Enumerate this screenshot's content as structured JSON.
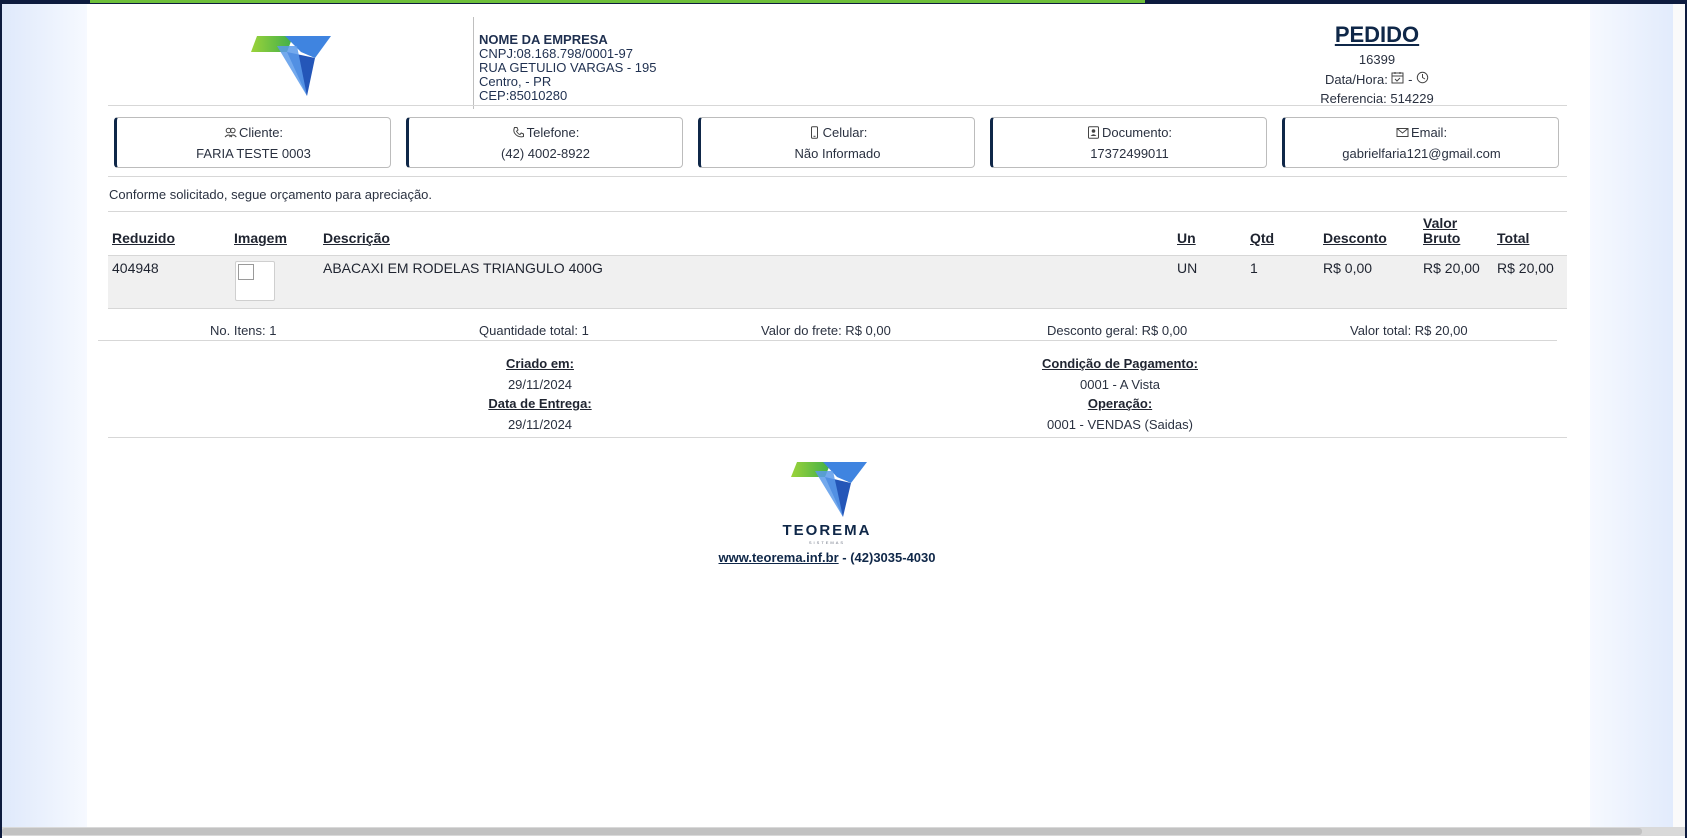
{
  "header": {
    "company_name": "NOME DA EMPRESA",
    "cnpj": "CNPJ:08.168.798/0001-97",
    "street": "RUA GETULIO VARGAS - 195",
    "city": "Centro, - PR",
    "cep": "CEP:85010280",
    "order_title": "PEDIDO",
    "order_number": "16399",
    "datetime_label": "Data/Hora:",
    "datetime_separator": "-",
    "reference": "Referencia: 514229"
  },
  "cards": [
    {
      "label": "Cliente:",
      "value": "FARIA TESTE 0003",
      "icon": "users-icon"
    },
    {
      "label": "Telefone:",
      "value": "(42) 4002-8922",
      "icon": "phone-icon"
    },
    {
      "label": "Celular:",
      "value": "Não Informado",
      "icon": "mobile-icon"
    },
    {
      "label": "Documento:",
      "value": "17372499011",
      "icon": "id-card-icon"
    },
    {
      "label": "Email:",
      "value": "gabrielfaria121@gmail.com",
      "icon": "envelope-icon"
    }
  ],
  "intro": "Conforme solicitado, segue orçamento para apreciação.",
  "table": {
    "headers": {
      "reduzido": "Reduzido",
      "imagem": "Imagem",
      "descricao": "Descrição",
      "un": "Un",
      "qtd": "Qtd",
      "desconto": "Desconto",
      "valor_bruto_1": "Valor",
      "valor_bruto_2": "Bruto",
      "total": "Total"
    },
    "rows": [
      {
        "reduzido": "404948",
        "descricao": "ABACAXI EM RODELAS TRIANGULO 400G",
        "un": "UN",
        "qtd": "1",
        "desconto": "R$ 0,00",
        "valor_bruto": "R$ 20,00",
        "total": "R$ 20,00"
      }
    ]
  },
  "summary": {
    "items": "No. Itens: 1",
    "quantity": "Quantidade total: 1",
    "freight": "Valor do frete: R$ 0,00",
    "discount": "Desconto geral: R$ 0,00",
    "total": "Valor total: R$ 20,00"
  },
  "meta": {
    "created_label": "Criado em:",
    "created_value": "29/11/2024",
    "delivery_label": "Data de Entrega:",
    "delivery_value": "29/11/2024",
    "payment_label": "Condição de Pagamento:",
    "payment_value": "0001 - A Vista",
    "operation_label": "Operação:",
    "operation_value": "0001 - VENDAS (Saidas)"
  },
  "footer": {
    "brand": "TEOREMA",
    "brand_sub": "SISTEMAS",
    "site": "www.teorema.inf.br",
    "phone": " - (42)3035-4030"
  },
  "colors": {
    "navy": "#0f2748",
    "accent_green": "#6ebf3a",
    "logo_blue": "#2f6fd1"
  }
}
